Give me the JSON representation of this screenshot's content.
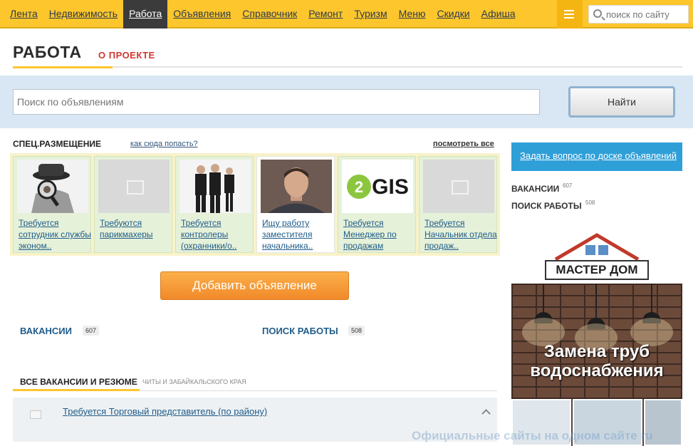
{
  "nav": {
    "items": [
      {
        "label": "Лента",
        "active": false
      },
      {
        "label": "Недвижимость",
        "active": false
      },
      {
        "label": "Работа",
        "active": true
      },
      {
        "label": "Объявления",
        "active": false
      },
      {
        "label": "Справочник",
        "active": false
      },
      {
        "label": "Ремонт",
        "active": false
      },
      {
        "label": "Туризм",
        "active": false
      },
      {
        "label": "Меню",
        "active": false
      },
      {
        "label": "Скидки",
        "active": false
      },
      {
        "label": "Афиша",
        "active": false
      }
    ],
    "menu_icon": "hamburger-icon",
    "search_placeholder": "поиск по сайту",
    "colors": {
      "bar": "#fcc62c",
      "active": "#3b3b3b"
    }
  },
  "header": {
    "title": "РАБОТА",
    "about_link": "О ПРОЕКТЕ"
  },
  "search": {
    "placeholder": "Поиск по объявлениям",
    "button": "Найти"
  },
  "spec": {
    "title": "СПЕЦ.РАЗМЕЩЕНИЕ",
    "how_link": "как сюда попасть?",
    "all_link": "посмотреть все",
    "cards": [
      {
        "caption": "Требуется сотрудник службы эконом..",
        "image": "detective-photo"
      },
      {
        "caption": "Требуются парикмахеры",
        "image": "placeholder"
      },
      {
        "caption": "Требуется контролеры (охранники/о..",
        "image": "guards-photo"
      },
      {
        "caption": "Ищу работу заместителя начальника..",
        "image": "portrait-photo"
      },
      {
        "caption": "Требуется Менеджер по продажам",
        "image": "2gis-logo",
        "logo_text": "GIS",
        "logo_digit": "2"
      },
      {
        "caption": "Требуется Начальник отдела продаж..",
        "image": "placeholder"
      }
    ]
  },
  "add_button": "Добавить объявление",
  "categories": [
    {
      "label": "ВАКАНСИИ",
      "count": "607"
    },
    {
      "label": "ПОИСК РАБОТЫ",
      "count": "508"
    }
  ],
  "all_section": {
    "title": "ВСЕ ВАКАНСИИ И РЕЗЮМЕ",
    "subtitle": "ЧИТЫ И ЗАБАЙКАЛЬСКОГО КРАЯ",
    "listings": [
      {
        "title": "Требуется Торговый представитель (по району)"
      }
    ]
  },
  "sidebar": {
    "ask_button": "Задать вопрос по доске объявлений",
    "categories": [
      {
        "label": "ВАКАНСИИ",
        "count": "607"
      },
      {
        "label": "ПОИСК РАБОТЫ",
        "count": "508"
      }
    ],
    "ad": {
      "brand": "МАСТЕР ДОМ",
      "headline_1": "Замена труб",
      "headline_2": "водоснабжения"
    }
  },
  "watermark": "Официальные сайты на одном сайте ru"
}
